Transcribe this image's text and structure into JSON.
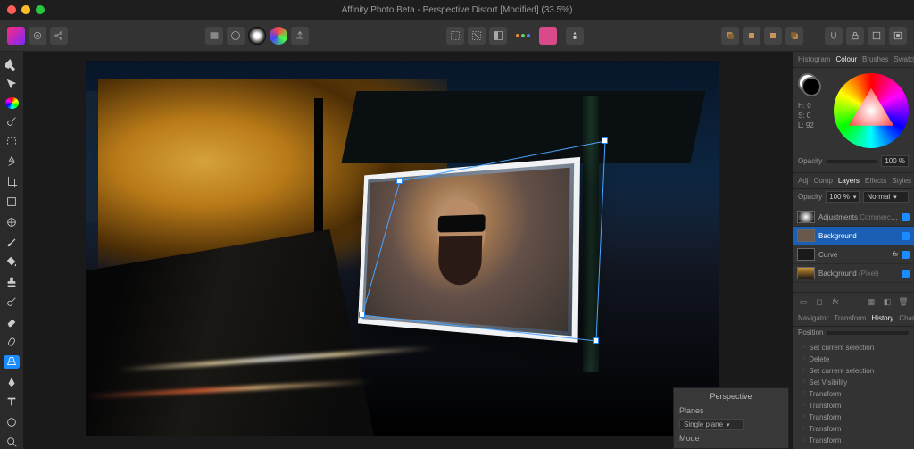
{
  "window": {
    "title": "Affinity Photo Beta - Perspective Distort [Modified] (33.5%)"
  },
  "hsl": {
    "h": "H: 0",
    "s": "S: 0",
    "l": "L: 92"
  },
  "opacity_label": "Opacity",
  "opacity_panel_slider": "100 %",
  "panel_tabs_top": {
    "histogram": "Histogram",
    "colour": "Colour",
    "brushes": "Brushes",
    "swatches": "Swatches"
  },
  "panel_tabs_mid": {
    "adj": "Adj",
    "comp": "Comp",
    "layers": "Layers",
    "effects": "Effects",
    "styles": "Styles"
  },
  "layers": {
    "opacity_label": "Opacity",
    "opacity_value": "100 %",
    "blend_mode": "Normal",
    "items": [
      {
        "name": "Adjustments",
        "suffix": "Commercialisé-emot"
      },
      {
        "name": "Background"
      },
      {
        "name": "Curve",
        "fx": "fx"
      },
      {
        "name": "Background",
        "suffix": "(Pixel)"
      }
    ]
  },
  "panel_tabs_hist": {
    "navigator": "Navigator",
    "transform": "Transform",
    "history": "History",
    "channels": "Channels"
  },
  "history": {
    "position_label": "Position",
    "items": [
      "Set current selection",
      "Delete",
      "Set current selection",
      "Set Visibility",
      "Transform",
      "Transform",
      "Transform",
      "Transform",
      "Transform"
    ]
  },
  "perspective_panel": {
    "title": "Perspective",
    "planes_label": "Planes",
    "planes_value": "Single plane",
    "mode_label": "Mode"
  }
}
